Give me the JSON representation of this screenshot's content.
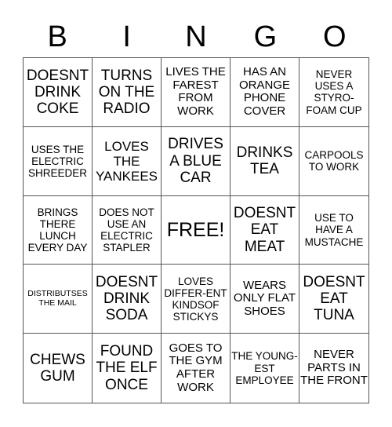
{
  "header": {
    "letters": [
      "B",
      "I",
      "N",
      "G",
      "O"
    ]
  },
  "cells": [
    "DOESNT DRINK COKE",
    "TURNS ON THE RADIO",
    "LIVES THE FAREST FROM WORK",
    "HAS AN ORANGE PHONE COVER",
    "NEVER USES A STYRO- FOAM CUP",
    "USES THE ELECTRIC SHREEDER",
    "LOVES THE YANKEES",
    "DRIVES A BLUE CAR",
    "DRINKS TEA",
    "CARPOOLS TO WORK",
    "BRINGS THERE LUNCH EVERY DAY",
    "DOES NOT USE AN ELECTRIC STAPLER",
    "FREE!",
    "DOESNT EAT MEAT",
    "USE TO HAVE A MUSTACHE",
    "DISTRIBUTSES THE MAIL",
    "DOESNT DRINK SODA",
    "LOVES DIFFER-ENT KINDSOF STICKYS",
    "WEARS ONLY FLAT SHOES",
    "DOESNT EAT TUNA",
    "CHEWS GUM",
    "FOUND THE ELF ONCE",
    "GOES TO THE GYM AFTER WORK",
    "THE YOUNG- EST EMPLOYEE",
    "NEVER PARTS IN THE FRONT"
  ]
}
